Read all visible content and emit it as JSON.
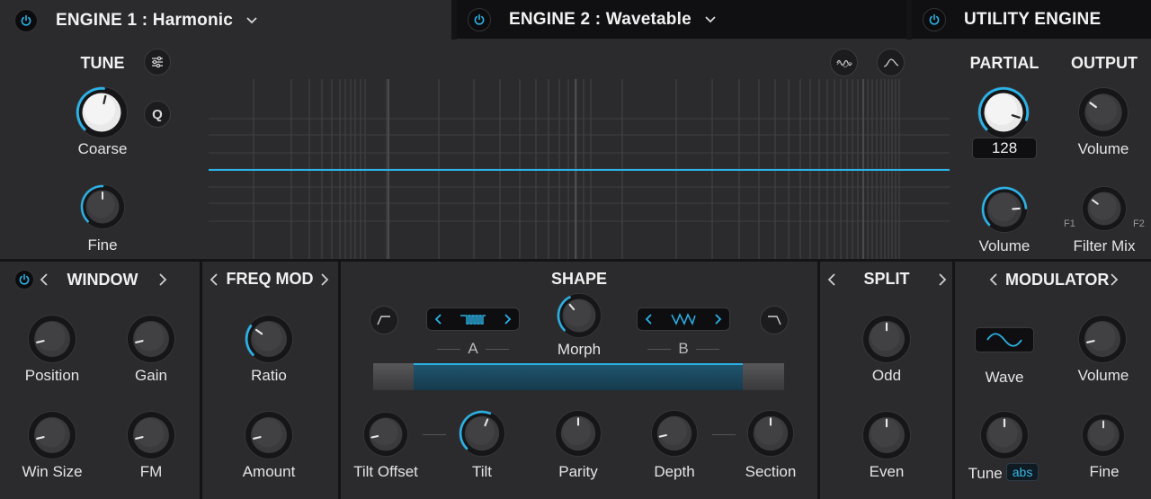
{
  "tabs": [
    {
      "label": "ENGINE 1 : Harmonic",
      "active": true
    },
    {
      "label": "ENGINE 2 : Wavetable",
      "active": false
    },
    {
      "label": "UTILITY ENGINE",
      "active": false
    }
  ],
  "tune": {
    "title": "TUNE",
    "q_label": "Q",
    "coarse": "Coarse",
    "fine": "Fine"
  },
  "partial": {
    "title": "PARTIAL",
    "value": "128",
    "volume": "Volume"
  },
  "output": {
    "title": "OUTPUT",
    "volume": "Volume",
    "filter_mix": "Filter Mix",
    "f1": "F1",
    "f2": "F2"
  },
  "window": {
    "title": "WINDOW",
    "position": "Position",
    "gain": "Gain",
    "win_size": "Win Size",
    "fm": "FM"
  },
  "freq_mod": {
    "title": "FREQ MOD",
    "ratio": "Ratio",
    "amount": "Amount"
  },
  "shape": {
    "title": "SHAPE",
    "a": "A",
    "morph": "Morph",
    "b": "B",
    "tilt_offset": "Tilt Offset",
    "tilt": "Tilt",
    "parity": "Parity",
    "depth": "Depth",
    "section": "Section"
  },
  "split": {
    "title": "SPLIT",
    "odd": "Odd",
    "even": "Even"
  },
  "modulator": {
    "title": "MODULATOR",
    "wave": "Wave",
    "volume": "Volume",
    "tune": "Tune",
    "tune_mode": "abs",
    "fine": "Fine"
  },
  "colors": {
    "accent": "#2bb2e6",
    "panel": "#2b2b2d",
    "background": "#141416"
  }
}
